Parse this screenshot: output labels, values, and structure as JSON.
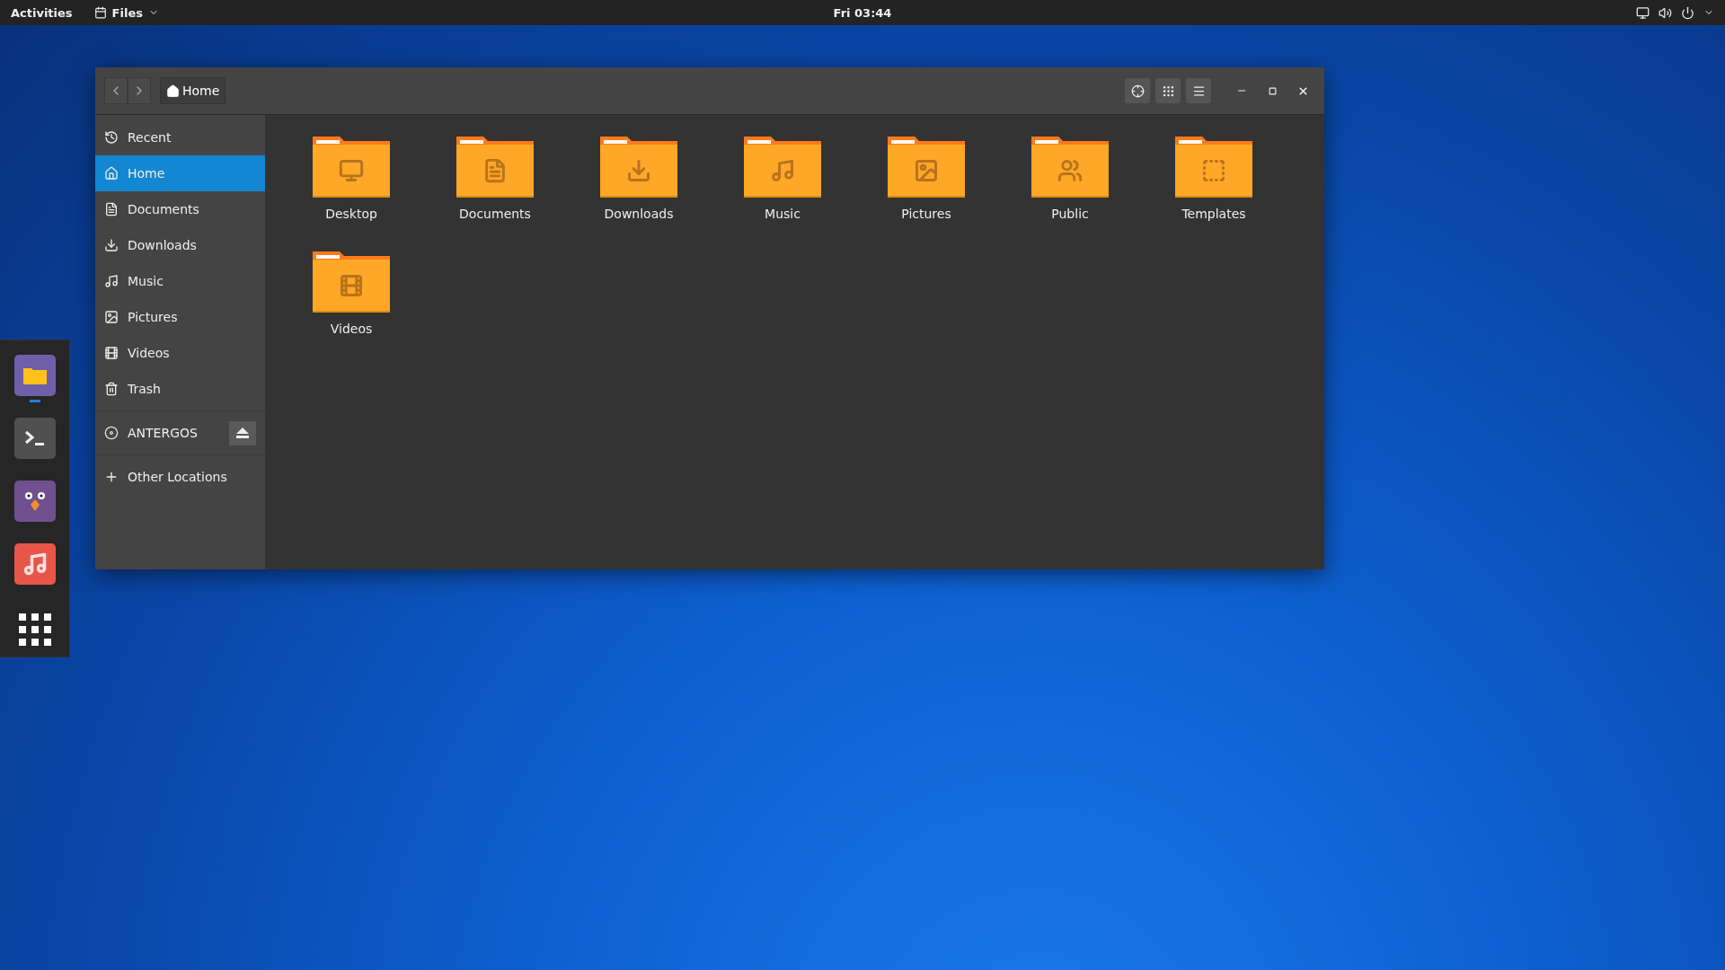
{
  "top_bar": {
    "activities": "Activities",
    "app_menu": "Files",
    "clock": "Fri 03:44"
  },
  "window": {
    "path": "Home",
    "sidebar": {
      "places": [
        {
          "label": "Recent",
          "selected": false
        },
        {
          "label": "Home",
          "selected": true
        },
        {
          "label": "Documents",
          "selected": false
        },
        {
          "label": "Downloads",
          "selected": false
        },
        {
          "label": "Music",
          "selected": false
        },
        {
          "label": "Pictures",
          "selected": false
        },
        {
          "label": "Videos",
          "selected": false
        },
        {
          "label": "Trash",
          "selected": false
        }
      ],
      "devices": [
        {
          "label": "ANTERGOS"
        }
      ],
      "other_locations": "Other Locations"
    },
    "folders": [
      {
        "label": "Desktop"
      },
      {
        "label": "Documents"
      },
      {
        "label": "Downloads"
      },
      {
        "label": "Music"
      },
      {
        "label": "Pictures"
      },
      {
        "label": "Public"
      },
      {
        "label": "Templates"
      },
      {
        "label": "Videos"
      }
    ]
  },
  "dock": [
    {
      "running": true
    },
    {
      "running": false
    },
    {
      "running": false
    },
    {
      "running": false
    }
  ]
}
